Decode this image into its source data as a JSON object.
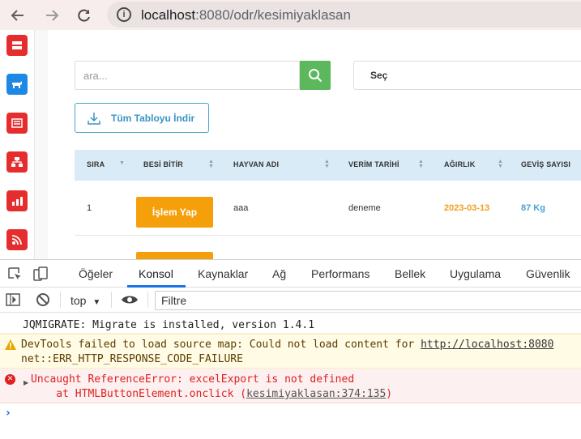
{
  "browser": {
    "url_host": "localhost",
    "url_path": ":8080/odr/kesimiyaklasan",
    "back_icon": "back-arrow-icon",
    "forward_icon": "forward-arrow-icon",
    "reload_icon": "reload-icon"
  },
  "sidebar": {
    "items": [
      {
        "icon": "server-icon",
        "color": "#e52d2d"
      },
      {
        "icon": "cow-icon",
        "color": "#1e88e5"
      },
      {
        "icon": "list-icon",
        "color": "#e52d2d"
      },
      {
        "icon": "network-icon",
        "color": "#e52d2d"
      },
      {
        "icon": "chart-icon",
        "color": "#e52d2d"
      },
      {
        "icon": "rss-icon",
        "color": "#e52d2d"
      }
    ]
  },
  "search": {
    "placeholder": "ara...",
    "button_icon": "search-icon"
  },
  "select": {
    "value": "Seç"
  },
  "download": {
    "label": "Tüm Tabloyu İndir",
    "icon": "download-icon"
  },
  "table": {
    "columns": [
      "SIRA",
      "BESİ BİTİR",
      "HAYVAN ADI",
      "VERİM TARİHİ",
      "AĞIRLIK",
      "GEVİŞ SAYISI"
    ],
    "rows": [
      {
        "sira": "1",
        "action": "İşlem Yap",
        "hayvan_adi": "aaa",
        "verim_tarihi": "deneme",
        "agirlik": "2023-03-13",
        "gevis": "87 Kg"
      }
    ]
  },
  "colors": {
    "accent_green": "#5cb85c",
    "action_orange": "#f5a00b",
    "header_blue": "#d9ebf6",
    "date_orange": "#f0a020",
    "kg_blue": "#4aa3d6"
  },
  "devtools": {
    "tabs": [
      "Öğeler",
      "Konsol",
      "Kaynaklar",
      "Ağ",
      "Performans",
      "Bellek",
      "Uygulama",
      "Güvenlik"
    ],
    "active_tab": "Konsol",
    "context": "top",
    "filter_placeholder": "Filtre",
    "messages": {
      "log": "JQMIGRATE: Migrate is installed, version 1.4.1",
      "warn_line1": "DevTools failed to load source map: Could not load content for ",
      "warn_link": "http://localhost:8080",
      "warn_line2": "net::ERR_HTTP_RESPONSE_CODE_FAILURE",
      "err_line1": "Uncaught ReferenceError: excelExport is not defined",
      "err_line2_prefix": "    at HTMLButtonElement.onclick (",
      "err_link": "kesimiyaklasan:374:135",
      "err_line2_suffix": ")"
    },
    "prompt": "›"
  }
}
